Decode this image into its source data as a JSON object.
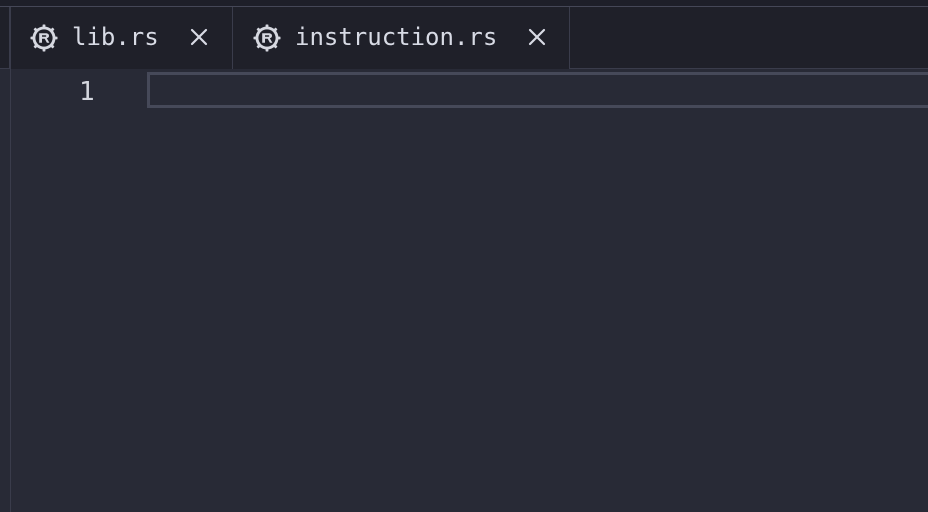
{
  "tabs": [
    {
      "label": "lib.rs",
      "icon": "rust-icon",
      "close_icon": "close-icon"
    },
    {
      "label": "instruction.rs",
      "icon": "rust-icon",
      "close_icon": "close-icon"
    }
  ],
  "editor": {
    "line_numbers": [
      "1"
    ],
    "lines": [
      ""
    ]
  },
  "colors": {
    "background": "#282a36",
    "tab_bar": "#1f2029",
    "text": "#d8dbe5",
    "border": "#3a3c4b"
  }
}
